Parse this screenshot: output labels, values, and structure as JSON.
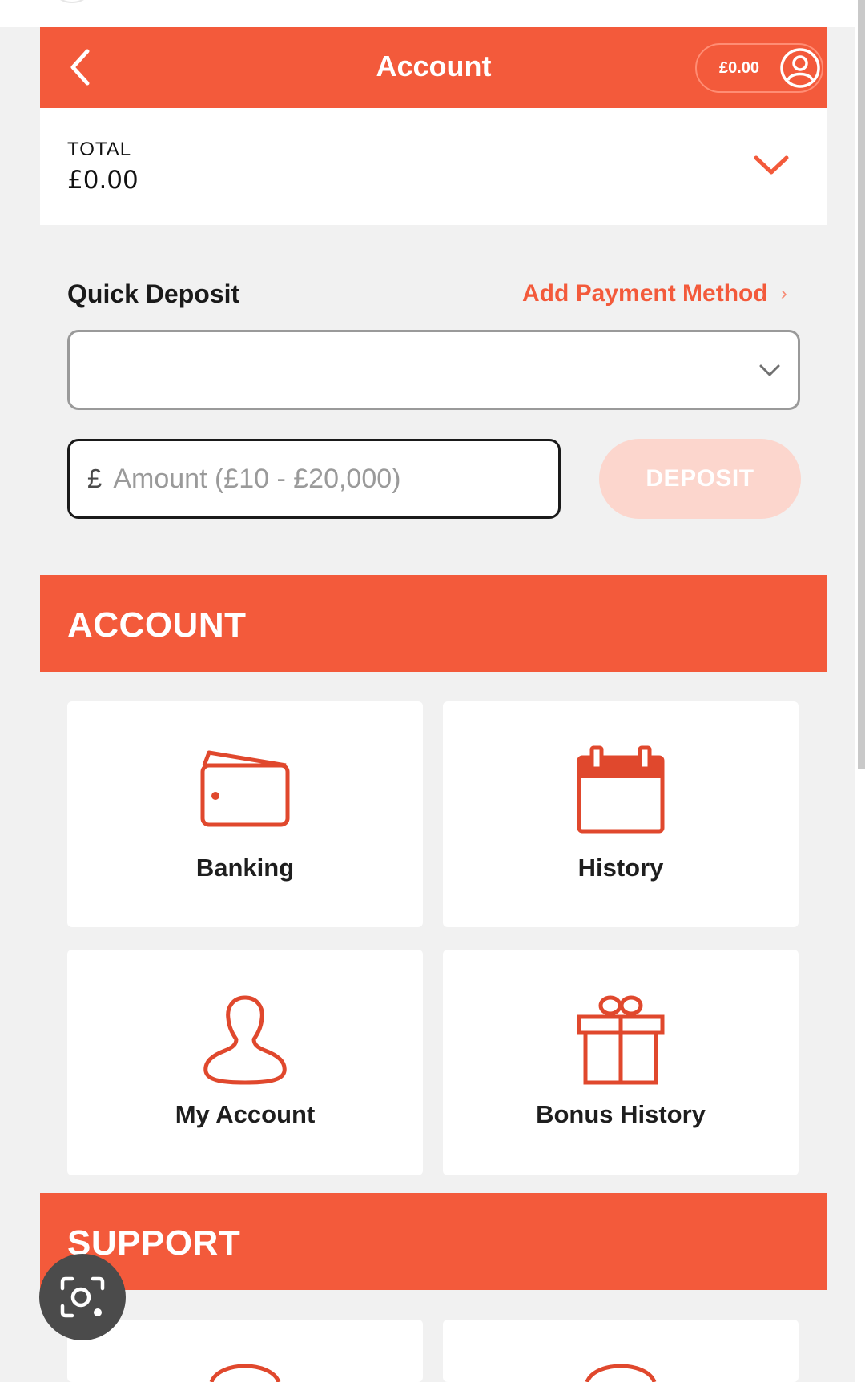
{
  "header": {
    "title": "Account",
    "balance": "£0.00",
    "back_icon": "chevron-left-icon",
    "avatar_icon": "user-avatar-icon"
  },
  "total": {
    "label": "TOTAL",
    "value": "£0.00",
    "toggle_icon": "chevron-down-icon"
  },
  "quick_deposit": {
    "label": "Quick Deposit",
    "add_payment": "Add Payment Method",
    "add_payment_chevron": "›",
    "select_value": "",
    "currency": "£",
    "amount_placeholder": "Amount (£10 - £20,000)",
    "deposit_label": "DEPOSIT"
  },
  "account_section": {
    "title": "ACCOUNT",
    "tiles": [
      {
        "label": "Banking",
        "icon": "wallet-icon"
      },
      {
        "label": "History",
        "icon": "calendar-icon"
      },
      {
        "label": "My Account",
        "icon": "user-icon"
      },
      {
        "label": "Bonus History",
        "icon": "gift-icon"
      }
    ]
  },
  "support_section": {
    "title": "SUPPORT"
  },
  "colors": {
    "brand": "#f35a3b",
    "background": "#f1f1f1",
    "deposit_disabled": "#fcd6cd"
  }
}
